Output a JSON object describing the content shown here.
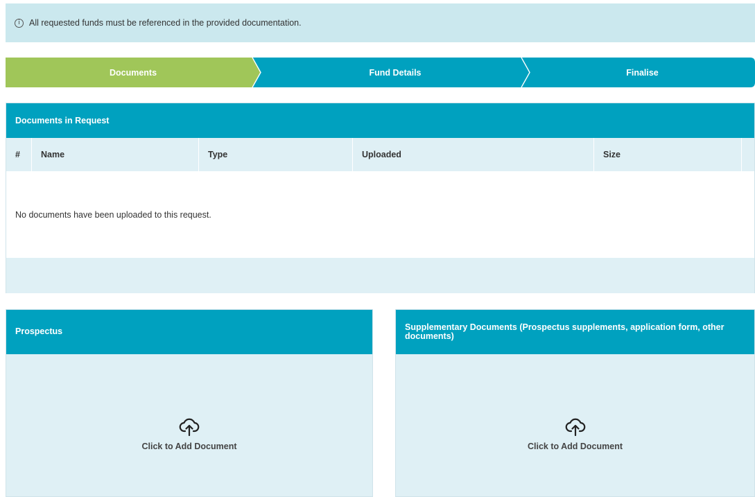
{
  "notice": {
    "icon": "info-icon",
    "text": "All requested funds must be referenced in the provided documentation."
  },
  "stepper": {
    "steps": [
      {
        "label": "Documents",
        "state": "active"
      },
      {
        "label": "Fund Details",
        "state": "pending"
      },
      {
        "label": "Finalise",
        "state": "pending"
      }
    ]
  },
  "documents": {
    "title": "Documents in Request",
    "columns": [
      "#",
      "Name",
      "Type",
      "Uploaded",
      "Size"
    ],
    "empty_message": "No documents have been uploaded to this request."
  },
  "prospectus": {
    "title": "Prospectus",
    "action_label": "Click to Add Document",
    "icon": "cloud-upload-icon"
  },
  "supplementary": {
    "title": "Supplementary Documents (Prospectus supplements, application form, other documents)",
    "action_label": "Click to Add Document",
    "icon": "cloud-upload-icon"
  },
  "colors": {
    "active_step": "#a0c659",
    "step": "#00a1bf",
    "header": "#00a1bf",
    "notice_bg": "#cbe8ee",
    "light_panel": "#dff0f5"
  }
}
